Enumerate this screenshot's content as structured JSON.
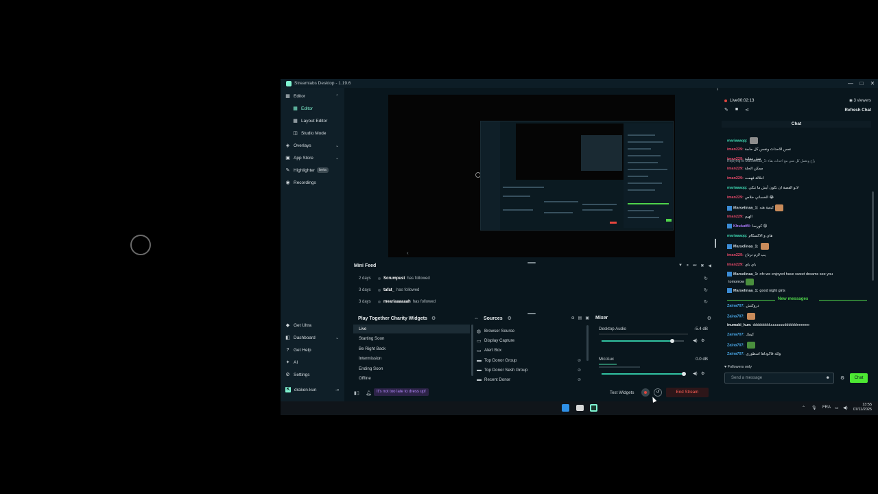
{
  "window": {
    "title": "Streamlabs Desktop - 1.19.6",
    "controls": [
      "—",
      "□",
      "✕"
    ]
  },
  "sidebar": {
    "items": [
      {
        "label": "Editor",
        "icon": "layout-icon"
      },
      {
        "label": "Editor",
        "icon": "grid-icon"
      },
      {
        "label": "Layout Editor",
        "icon": "grid-icon"
      },
      {
        "label": "Studio Mode",
        "icon": "split-icon"
      },
      {
        "label": "Overlays",
        "icon": "overlays-icon"
      },
      {
        "label": "App Store",
        "icon": "store-icon"
      },
      {
        "label": "Highlighter",
        "icon": "highlighter-icon",
        "badge": "beta"
      },
      {
        "label": "Recordings",
        "icon": "recordings-icon"
      }
    ],
    "bottom_items": [
      {
        "label": "Get Ultra",
        "icon": "ultra-icon"
      },
      {
        "label": "Dashboard",
        "icon": "dashboard-icon"
      },
      {
        "label": "Get Help",
        "icon": "help-icon"
      },
      {
        "label": "AI",
        "icon": "ai-icon"
      },
      {
        "label": "Settings",
        "icon": "gear-icon"
      }
    ],
    "user": "draken-kun"
  },
  "minifeed": {
    "title": "Mini Feed",
    "rows": [
      {
        "days": "2 days",
        "name": "Scrumpust",
        "action": "has followed"
      },
      {
        "days": "3 days",
        "name": "tafat_",
        "action": "has followed"
      },
      {
        "days": "3 days",
        "name": "meariaaaaaah",
        "action": "has followed"
      }
    ]
  },
  "widgets": {
    "title": "Play Together Charity Widgets",
    "items": [
      "Live",
      "Starting Soon",
      "Be Right Back",
      "Intermission",
      "Ending Soon",
      "Offline"
    ]
  },
  "sources": {
    "title": "Sources",
    "items": [
      {
        "label": "Browser Source",
        "icon": "globe-icon"
      },
      {
        "label": "Display Capture",
        "icon": "monitor-icon"
      },
      {
        "label": "Alert Box",
        "icon": "alert-icon"
      },
      {
        "label": "Top Donor Group",
        "icon": "folder-icon"
      },
      {
        "label": "Top Donor Sesh Group",
        "icon": "folder-icon"
      },
      {
        "label": "Recent Donor",
        "icon": "folder-icon"
      }
    ]
  },
  "mixer": {
    "title": "Mixer",
    "channels": [
      {
        "name": "Desktop Audio",
        "db": "-5.4 dB",
        "level": 0.86
      },
      {
        "name": "Mic/Aux",
        "db": "0.0 dB",
        "level": 1.0
      }
    ]
  },
  "bottombar": {
    "ticker": "It's not too late to dress up!",
    "test_widgets": "Test Widgets",
    "end_stream": "End Stream"
  },
  "chat": {
    "live": "Live",
    "timer": "00:02:13",
    "viewers": "3 viewers",
    "refresh": "Refresh Chat",
    "header": "Chat",
    "messages": [
      {
        "user": "mariaaaqq:",
        "text": "",
        "color": "#3ed6b0",
        "emote": true
      },
      {
        "user": "iman229:",
        "text": "نفس الاحداث ونفس كل حاجة",
        "color": "#e84a6a"
      },
      {
        "user": "iman229:",
        "text": "مش مقلبة",
        "color": "#e84a6a"
      },
      {
        "user": "iman229:",
        "text": "ممكن الحلة",
        "color": "#e84a6a"
      },
      {
        "user": "iman229:",
        "text": "احلالة فهمت",
        "color": "#e84a6a"
      },
      {
        "user": "mariaaaqq:",
        "text": "لانو القصة ان تكون أيش ما تنكي",
        "color": "#3ed6b0"
      },
      {
        "user": "iman229:",
        "text": "الخساني خلاص 😂",
        "color": "#e84a6a"
      },
      {
        "user": "Marselinaa_1:",
        "text": "كيفية هنه",
        "color": "#d0d8dc",
        "badge": true
      },
      {
        "user": "iman229:",
        "text": "الهيم",
        "color": "#e84a6a"
      },
      {
        "user": "Khuludfil:",
        "text": "كورسا 😋",
        "color": "#b07cff",
        "badge": true
      },
      {
        "user": "mariaaaqq:",
        "text": "هاي و الاكسكام",
        "color": "#3ed6b0"
      },
      {
        "user": "Marselinaa_1:",
        "text": "",
        "color": "#d0d8dc",
        "badge": true
      },
      {
        "user": "iman229:",
        "text": "يب لازم ترتاح",
        "color": "#e84a6a"
      },
      {
        "user": "iman229:",
        "text": "باي باي",
        "color": "#e84a6a"
      },
      {
        "user": "Marselinaa_1:",
        "text": "ofc we enjoyed have sweet dreams see you",
        "color": "#d0d8dc",
        "badge": true
      },
      {
        "user": "",
        "text": "tomorrow",
        "color": "#d0d8dc"
      },
      {
        "user": "Marselinaa_1:",
        "text": "good night girls",
        "color": "#d0d8dc",
        "badge": true
      },
      {
        "user": "Zaina707:",
        "text": "دروكتش",
        "color": "#4aa8e8"
      },
      {
        "user": "Zaina707:",
        "text": "",
        "color": "#4aa8e8"
      },
      {
        "user": "inumaki_kun:",
        "text": "dddddddduuuuuuuddddddeeeeee",
        "color": "#e6ecee"
      },
      {
        "user": "Zaina707:",
        "text": "كيفك",
        "color": "#4aa8e8"
      },
      {
        "user": "Zaina707:",
        "text": "",
        "color": "#4aa8e8"
      },
      {
        "user": "Zaina707:",
        "text": "ولله فاكوداها اسطوري",
        "color": "#4aa8e8"
      }
    ],
    "reply_line": "Replying to Marselinaa_1: راح ونعمل كل شي مع احداث بقاء",
    "new_messages": "New messages",
    "followers_only": "Followers only",
    "placeholder": "Send a message",
    "send": "Chat"
  },
  "taskbar": {
    "lang": "FRA",
    "time": "13:55",
    "date": "07/11/2025"
  }
}
